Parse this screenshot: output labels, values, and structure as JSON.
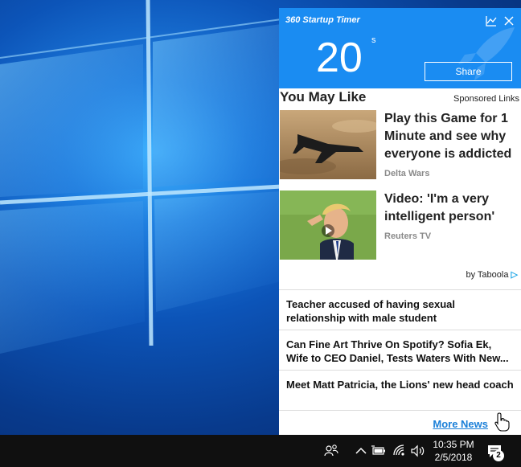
{
  "popup": {
    "app_title": "360 Startup Timer",
    "timer_value": "20",
    "timer_unit": "s",
    "share_label": "Share",
    "section_title": "You May Like",
    "sponsored_label": "Sponsored Links",
    "cards": [
      {
        "title": "Play this Game for 1 Minute and see why everyone is addicted",
        "source": "Delta Wars"
      },
      {
        "title": "Video: 'I'm a very intelligent person'",
        "source": "Reuters TV"
      }
    ],
    "by_label": "by Taboola",
    "news": [
      "Teacher accused of having sexual relationship with male student",
      "Can Fine Art Thrive On Spotify? Sofia Ek, Wife to CEO Daniel, Tests Waters With New...",
      "Meet Matt Patricia, the Lions' new head coach"
    ],
    "more_news_label": "More News",
    "colors": {
      "header_blue": "#1a8cf2",
      "link_blue": "#1a7fd8"
    }
  },
  "taskbar": {
    "time": "10:35 PM",
    "date": "2/5/2018",
    "notification_count": "2",
    "tray_icons": [
      "people-icon",
      "chevron-up-icon",
      "battery-icon",
      "wifi-icon",
      "speaker-icon",
      "action-center-icon"
    ]
  }
}
